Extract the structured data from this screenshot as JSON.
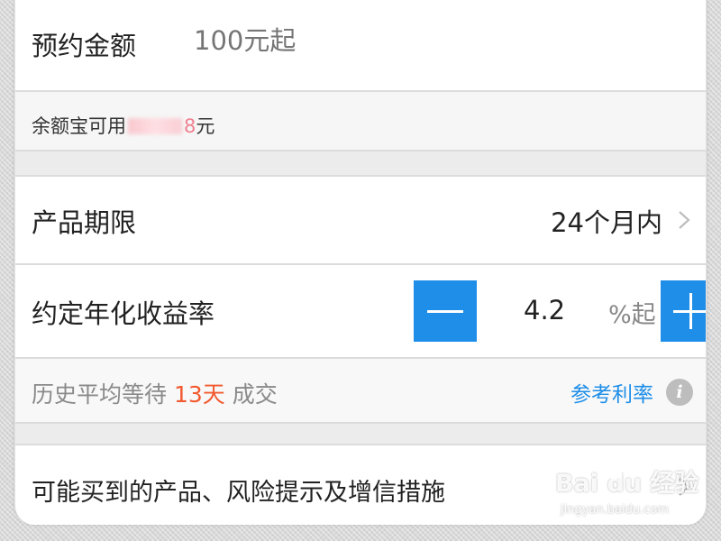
{
  "amount": {
    "label": "预约金额",
    "placeholder": "100元起"
  },
  "balance": {
    "prefix": "余额宝可用",
    "visible_digit": "8",
    "suffix": "元"
  },
  "period": {
    "label": "产品期限",
    "value": "24个月内",
    "chevron_icon": "chevron-right-icon"
  },
  "rate": {
    "label": "约定年化收益率",
    "value": "4.2",
    "unit": "%起",
    "minus_icon": "minus-icon",
    "plus_icon": "plus-icon"
  },
  "history": {
    "prefix": "历史平均等待 ",
    "days": "13天",
    "suffix": " 成交",
    "link": "参考利率",
    "info_icon": "info-icon"
  },
  "products": {
    "label": "可能买到的产品、风险提示及增信措施",
    "chevron_icon": "chevron-right-icon"
  },
  "watermark": {
    "logo": "Bai du 经验",
    "url": "jingyan.baidu.com"
  },
  "colors": {
    "accent": "#1e8ee8",
    "highlight": "#f25a30",
    "text": "#222222",
    "muted": "#8a8a8a"
  }
}
